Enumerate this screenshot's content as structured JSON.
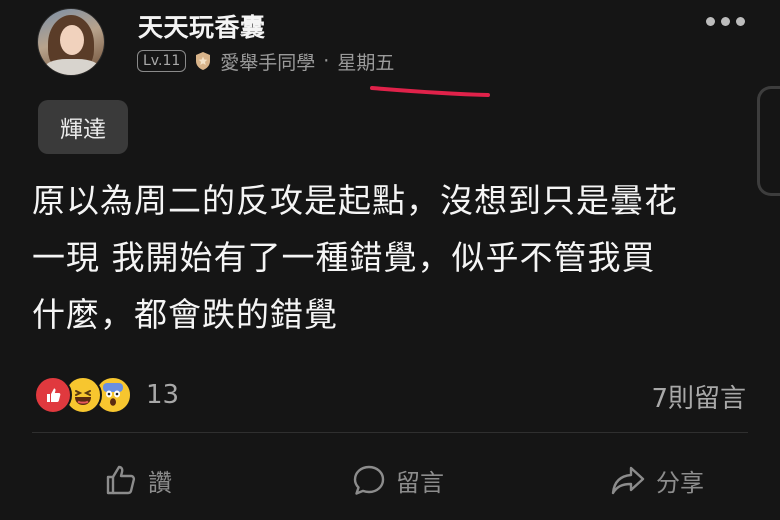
{
  "post": {
    "author": {
      "name": "天天玩香囊",
      "level": "Lv.11",
      "board": "愛舉手同學",
      "separator": "·",
      "time": "星期五"
    },
    "tag": "輝達",
    "lines": [
      "原以為周二的反攻是起點，沒想到只是曇花",
      "一現 我開始有了一種錯覺，似乎不管我買",
      "什麼，都會跌的錯覺"
    ],
    "reactions": {
      "types": [
        "like-icon",
        "laugh-icon",
        "scared-icon"
      ],
      "count": "13"
    },
    "comment_count": "7則留言"
  },
  "actions": {
    "like_label": "讚",
    "comment_label": "留言",
    "share_label": "分享"
  },
  "colors": {
    "background": "#151515",
    "text_primary": "#f2f2f2",
    "text_muted": "#9a9a9a",
    "tag_bg": "#3a3a3a",
    "annotation_red": "#e0224a",
    "like_red": "#e0393e",
    "emoji_yellow": "#f7c62f"
  },
  "icons": {
    "more": "more-horizontal-icon",
    "badge": "shield-icon",
    "like": "thumbs-up-icon",
    "comment": "comment-bubble-icon",
    "share": "share-arrow-icon"
  }
}
